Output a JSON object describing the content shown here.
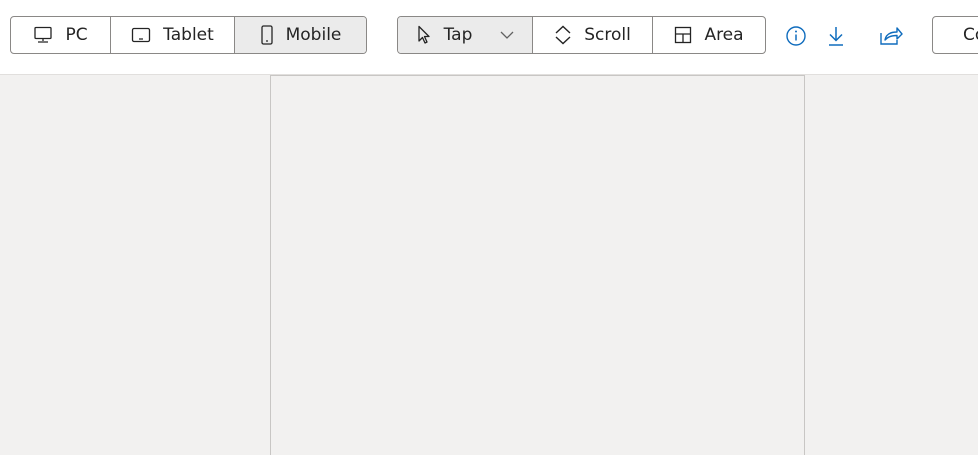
{
  "device_group": {
    "pc_label": "PC",
    "tablet_label": "Tablet",
    "mobile_label": "Mobile",
    "selected": "Mobile"
  },
  "mode_group": {
    "tap_label": "Tap",
    "scroll_label": "Scroll",
    "area_label": "Area",
    "selected": "Tap"
  },
  "actions": {
    "info_icon": "info-icon",
    "download_icon": "download-icon",
    "share_icon": "share-icon",
    "cut_button_label": "Co"
  },
  "colors": {
    "accent": "#0f6cbd",
    "border": "#8a8886",
    "selected_bg": "#ebebeb",
    "canvas_bg": "#f2f1f0"
  }
}
